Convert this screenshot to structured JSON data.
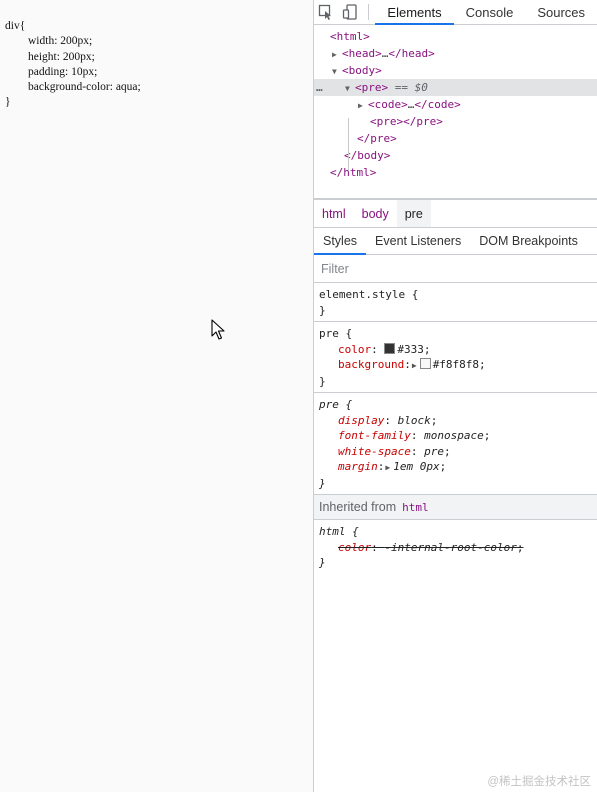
{
  "page_source": {
    "code": "div{\n        width: 200px;\n        height: 200px;\n        padding: 10px;\n        background-color: aqua;\n}"
  },
  "devtools": {
    "toolbar": {
      "icons": [
        "inspect-element-icon",
        "device-toolbar-icon"
      ],
      "tabs": [
        {
          "label": "Elements",
          "active": true
        },
        {
          "label": "Console",
          "active": false
        },
        {
          "label": "Sources",
          "active": false
        }
      ]
    },
    "dom_tree": {
      "lines": [
        {
          "open": "<html>"
        },
        {
          "open": "<head>",
          "ellipsis": "…",
          "close": "</head>"
        },
        {
          "open": "<body>"
        },
        {
          "open": "<pre>",
          "suffix": " == $0"
        },
        {
          "open": "<code>",
          "ellipsis": "…",
          "close": "</code>"
        },
        {
          "open": "<pre>",
          "close": "</pre>"
        },
        {
          "close": "</pre>"
        },
        {
          "close": "</body>"
        },
        {
          "close": "</html>"
        }
      ],
      "selected_dots": "…"
    },
    "breadcrumb": [
      "html",
      "body",
      "pre"
    ],
    "styles_tabs": [
      {
        "label": "Styles",
        "active": true
      },
      {
        "label": "Event Listeners",
        "active": false
      },
      {
        "label": "DOM Breakpoints",
        "active": false
      }
    ],
    "filter": {
      "placeholder": "Filter",
      "value": ""
    },
    "rules": {
      "element_style": {
        "selector": "element.style",
        "open": "{",
        "close": "}"
      },
      "pre_author": {
        "selector": "pre",
        "open": "{",
        "close": "}",
        "color_name": "color",
        "color_value": "#333",
        "background_name": "background",
        "background_value": "#f8f8f8",
        "swatch_colors": [
          "#333333",
          "#f8f8f8"
        ]
      },
      "pre_ua": {
        "selector": "pre",
        "open": "{",
        "close": "}",
        "props": [
          {
            "name": "display",
            "value": "block"
          },
          {
            "name": "font-family",
            "value": "monospace"
          },
          {
            "name": "white-space",
            "value": "pre"
          },
          {
            "name": "margin",
            "value": "1em 0px"
          }
        ]
      },
      "inherited": {
        "label": "Inherited from",
        "tag": "html"
      },
      "html_ua": {
        "selector": "html",
        "open": "{",
        "close": "}",
        "prop_name": "color",
        "prop_value": "-internal-root-color"
      }
    },
    "watermark": "@稀土掘金技术社区"
  }
}
